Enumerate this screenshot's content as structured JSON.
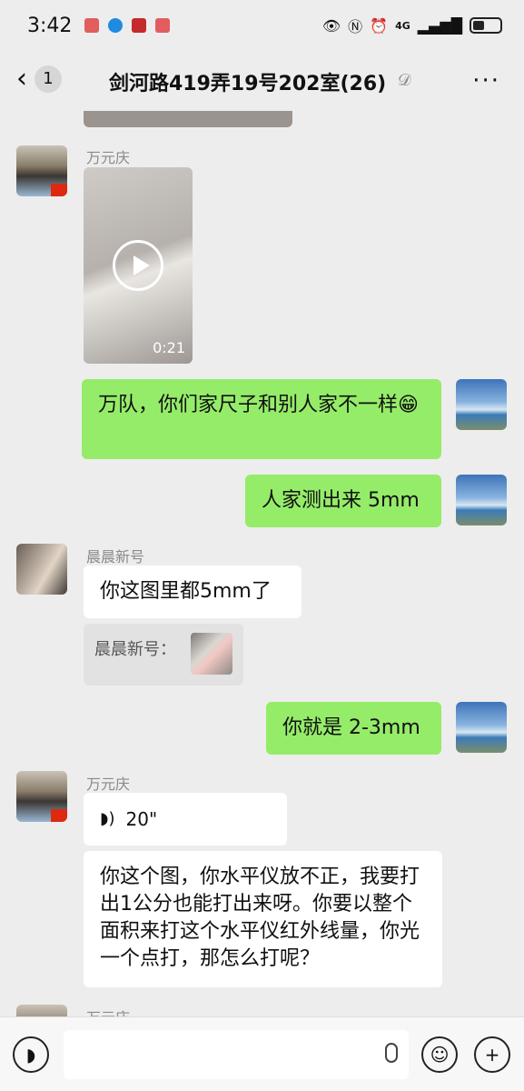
{
  "status_bar": {
    "time": "3:42",
    "network": "4G"
  },
  "nav": {
    "unread_count": "1",
    "title": "剑河路419弄19号202室(26)"
  },
  "messages": {
    "m1_sender": "万元庆",
    "m1_video_duration": "0:21",
    "m2_text": "万队，你们家尺子和别人家不一样😁",
    "m3_text": "人家测出来 5mm",
    "m4_sender": "晨晨新号",
    "m4_text": "你这图里都5mm了",
    "m4_quote": "晨晨新号：",
    "m5_text": "你就是 2-3mm",
    "m6_sender": "万元庆",
    "m6_voice": "20\"",
    "m7_text": "你这个图，你水平仪放不正，我要打出1公分也能打出来呀。你要以整个面积来打这个水平仪红外线量，你光一个点打，那怎么打呢？",
    "m8_sender": "万元庆"
  },
  "icons": [
    "back-icon",
    "ear-icon",
    "more-icon",
    "play-icon",
    "voice-icon",
    "mic-icon",
    "emoji-icon",
    "plus-icon"
  ]
}
